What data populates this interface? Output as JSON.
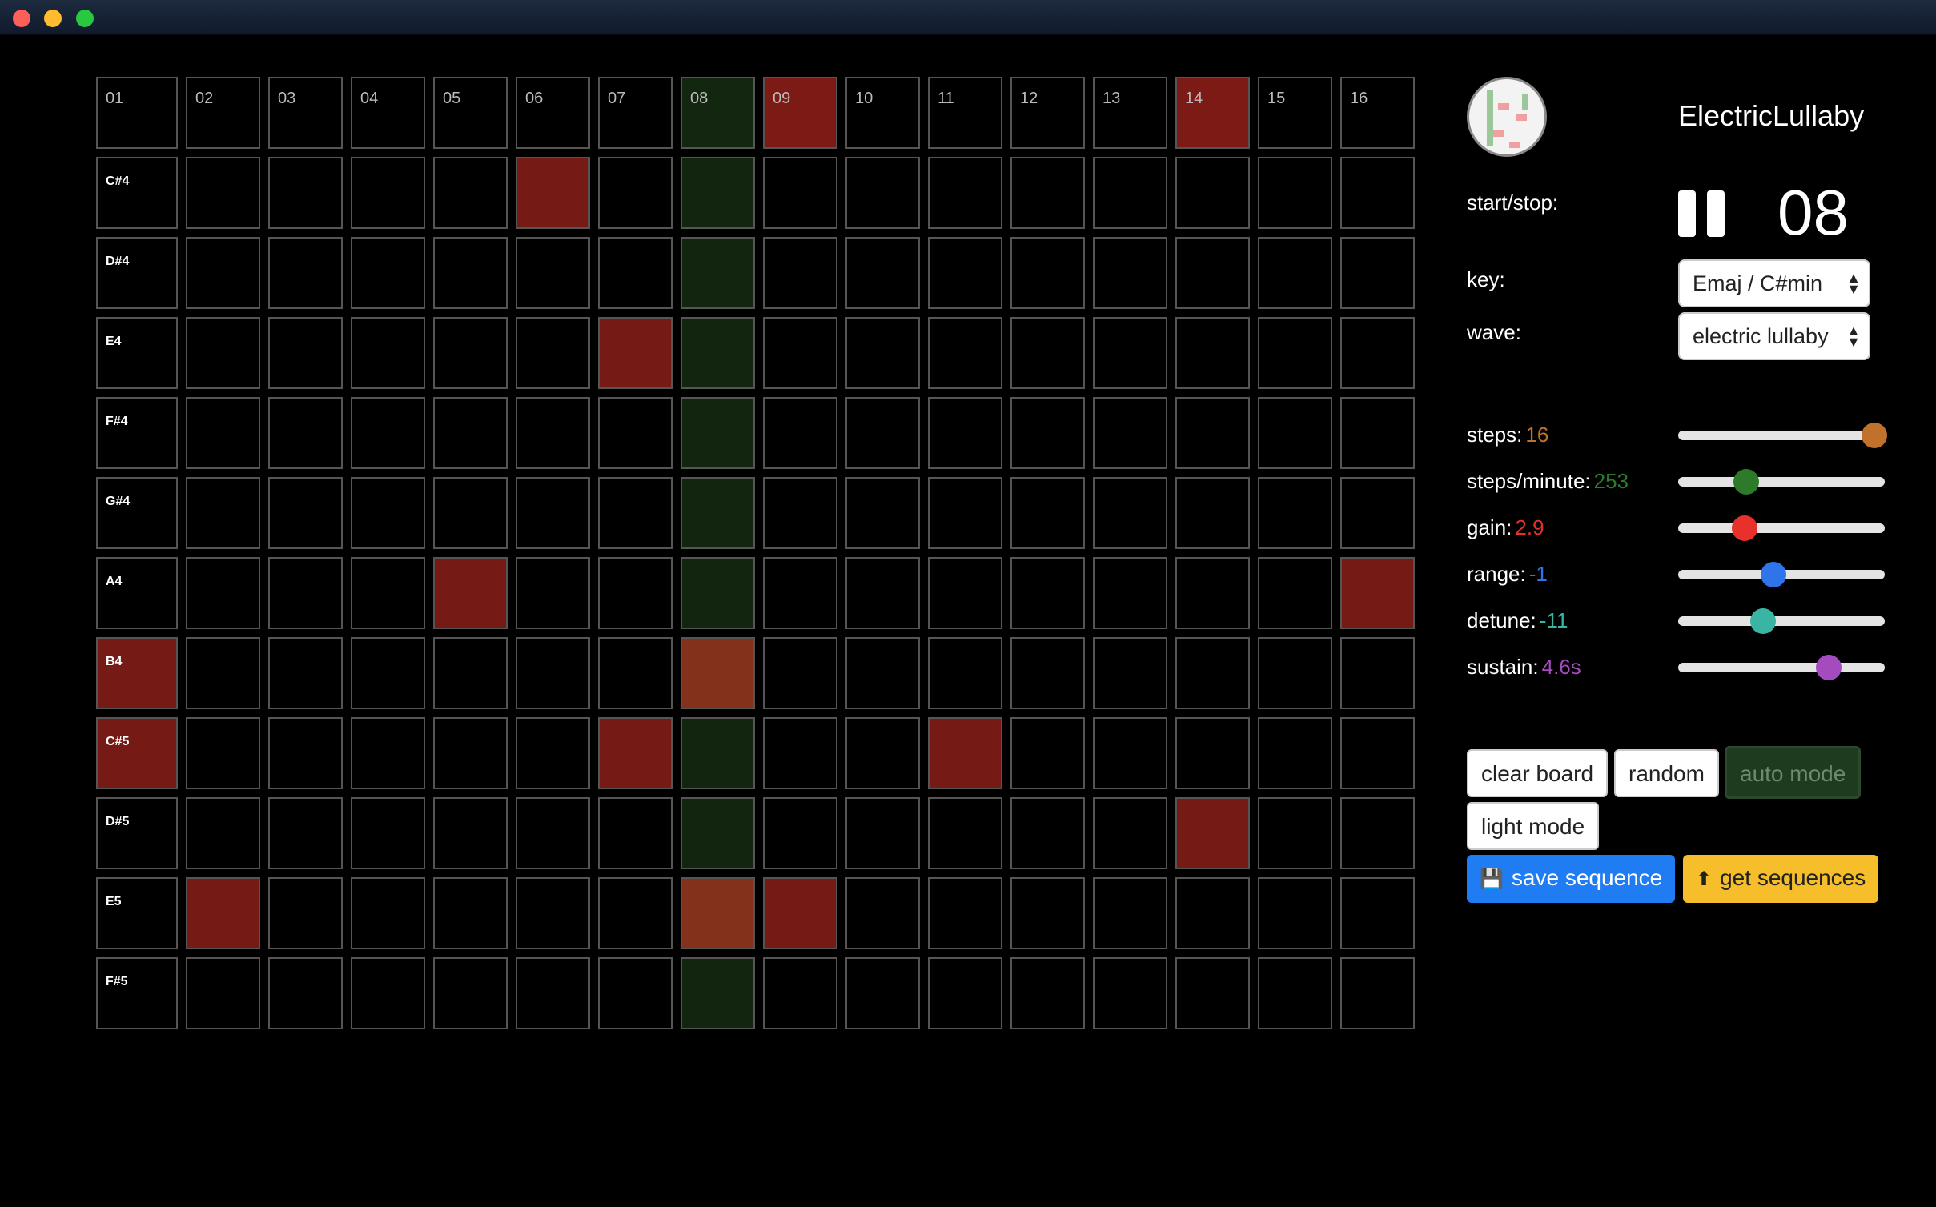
{
  "window": {},
  "grid": {
    "step_headers": [
      "01",
      "02",
      "03",
      "04",
      "05",
      "06",
      "07",
      "08",
      "09",
      "10",
      "11",
      "12",
      "13",
      "14",
      "15",
      "16"
    ],
    "current_step_index": 7,
    "active_headers": [
      8,
      13
    ],
    "notes": [
      {
        "name": "C#4",
        "active": [
          5
        ]
      },
      {
        "name": "D#4",
        "active": []
      },
      {
        "name": "E4",
        "active": [
          6
        ]
      },
      {
        "name": "F#4",
        "active": []
      },
      {
        "name": "G#4",
        "active": []
      },
      {
        "name": "A4",
        "active": [
          4,
          15
        ]
      },
      {
        "name": "B4",
        "active": [
          0,
          7
        ]
      },
      {
        "name": "C#5",
        "active": [
          0,
          6,
          10
        ]
      },
      {
        "name": "D#5",
        "active": [
          13
        ]
      },
      {
        "name": "E5",
        "active": [
          1,
          7,
          8
        ]
      },
      {
        "name": "F#5",
        "active": []
      }
    ]
  },
  "panel": {
    "title": "ElectricLullaby",
    "start_stop_label": "start/stop:",
    "current_step": "08",
    "key_label": "key:",
    "key_value": "Emaj / C#min",
    "wave_label": "wave:",
    "wave_value": "electric lullaby",
    "sliders": [
      {
        "label": "steps:",
        "value": "16",
        "fraction": 0.95,
        "color": "#c0722c"
      },
      {
        "label": "steps/minute:",
        "value": "253",
        "fraction": 0.33,
        "color": "#2d7a2a"
      },
      {
        "label": "gain:",
        "value": "2.9",
        "fraction": 0.32,
        "color": "#e8312b"
      },
      {
        "label": "range:",
        "value": "-1",
        "fraction": 0.46,
        "color": "#2f74e8"
      },
      {
        "label": "detune:",
        "value": "-11",
        "fraction": 0.41,
        "color": "#3ab5a4"
      },
      {
        "label": "sustain:",
        "value": "4.6s",
        "fraction": 0.73,
        "color": "#a44bc0"
      }
    ],
    "buttons": {
      "clear": "clear board",
      "random": "random",
      "auto": "auto mode",
      "light": "light mode",
      "save": "save sequence",
      "get": "get sequences"
    }
  }
}
